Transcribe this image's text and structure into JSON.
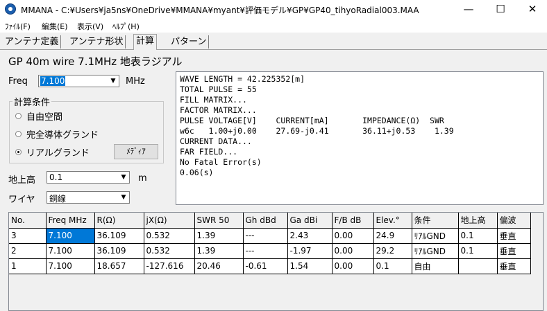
{
  "window": {
    "title": "MMANA - C:¥Users¥ja5ns¥OneDrive¥MMANA¥myant¥評価モデル¥GP¥GP40_tihyoRadial003.MAA",
    "minimize_glyph": "—",
    "maximize_glyph": "☐",
    "close_glyph": "✕"
  },
  "menu": {
    "file": "ﾌｧｲﾙ(F)",
    "edit": "編集(E)",
    "view": "表示(V)",
    "help": "ﾍﾙﾌﾟ(H)"
  },
  "tabs": [
    "アンテナ定義",
    "アンテナ形状",
    "計算",
    "パターン"
  ],
  "active_tab": "計算",
  "heading": "GP 40m wire 7.1MHz 地表ラジアル",
  "freq": {
    "label": "Freq",
    "value": "7.100",
    "unit": "MHz"
  },
  "calc_conditions": {
    "title": "計算条件",
    "options": [
      "自由空間",
      "完全導体グランド",
      "リアルグランド"
    ],
    "selected": "リアルグランド",
    "media_button": "ﾒﾃﾞｨｱ"
  },
  "height": {
    "label": "地上高",
    "value": "0.1",
    "unit": "m"
  },
  "wire": {
    "label": "ワイヤ",
    "value": "銅線"
  },
  "output_lines": [
    "WAVE LENGTH = 42.225352[m]",
    "TOTAL PULSE = 55",
    "FILL MATRIX...",
    "FACTOR MATRIX...",
    "PULSE VOLTAGE[V]    CURRENT[mA]       IMPEDANCE(Ω)  SWR",
    "w6c   1.00+j0.00    27.69-j0.41       36.11+j0.53    1.39",
    "CURRENT DATA...",
    "FAR FIELD...",
    "No Fatal Error(s)",
    "0.06(s)"
  ],
  "results_table": {
    "headers": [
      "No.",
      "Freq MHz",
      "R(Ω)",
      "jX(Ω)",
      "SWR 50",
      "Gh dBd",
      "Ga dBi",
      "F/B dB",
      "Elev.°",
      "条件",
      "地上高",
      "偏波"
    ],
    "rows": [
      [
        "3",
        "7.100",
        "36.109",
        "0.532",
        "1.39",
        "---",
        "2.43",
        "0.00",
        "24.9",
        "ﾘｱﾙGND",
        "0.1",
        "垂直"
      ],
      [
        "2",
        "7.100",
        "36.109",
        "0.532",
        "1.39",
        "---",
        "-1.97",
        "0.00",
        "29.2",
        "ﾘｱﾙGND",
        "0.1",
        "垂直"
      ],
      [
        "1",
        "7.100",
        "18.657",
        "-127.616",
        "20.46",
        "-0.61",
        "1.54",
        "0.00",
        "0.1",
        "自由",
        "",
        "垂直"
      ]
    ]
  }
}
